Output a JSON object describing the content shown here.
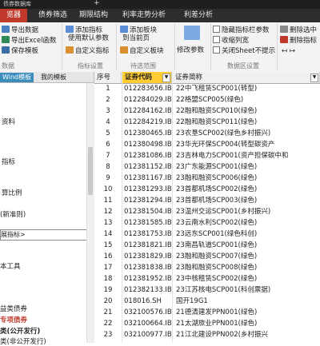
{
  "window": {
    "title": "债券数据库"
  },
  "menu": {
    "items": [
      {
        "label": "览器",
        "active": true
      },
      {
        "label": "债券筛选"
      },
      {
        "label": "期限结构"
      },
      {
        "label": "利率走势分析"
      },
      {
        "label": "利差分析"
      }
    ]
  },
  "ribbon": {
    "data_group": {
      "export_data": "导出数据",
      "export_excel": "导出Excel函数",
      "save_template": "保存模板",
      "label": "数据"
    },
    "indicator_group": {
      "add_indicator": "添加指标",
      "use_default": "使用默认参数",
      "custom_indicator": "自定义指标",
      "label": "指标设置"
    },
    "filter_group": {
      "add_board": "添加板块",
      "to_current_page": "到当前页",
      "custom_board": "自定义板块",
      "label": "待选范围"
    },
    "params": {
      "modify_params": "修改参数"
    },
    "view_group": {
      "hide_bar": "隐藏指标栏参数",
      "collapse_cols": "收缩列宽",
      "close_sheet": "关闭Sheet不提示",
      "label": "数据区设置"
    },
    "right": {
      "delete_selected": "删除选中",
      "delete_indicator": "删除指标",
      "arrows": "↤ ↦"
    }
  },
  "left_panel": {
    "tabs": [
      "Wind模板",
      "我的模板"
    ],
    "items": [
      "资料",
      "指标",
      "算比例",
      "(新准则)",
      "本工具",
      "益类债券",
      "专项债券",
      "类(公开发行)",
      "类(非公开发行)"
    ],
    "indicator_box": "展指标>"
  },
  "table": {
    "headers": {
      "seq": "序号",
      "code": "证券代码",
      "name": "证券简称"
    },
    "rows": [
      {
        "seq": "1",
        "code": "012283656.IB",
        "name": "22中飞租赁SCP001(转型)"
      },
      {
        "seq": "2",
        "code": "012284029.IB",
        "name": "22格盟SCP005(绿色)"
      },
      {
        "seq": "3",
        "code": "012284162.IB",
        "name": "22融和融资SCP010(绿色)"
      },
      {
        "seq": "4",
        "code": "012284219.IB",
        "name": "22融和融资SCP011(绿色)"
      },
      {
        "seq": "5",
        "code": "012380465.IB",
        "name": "23农垦SCP002(绿色乡村振兴)"
      },
      {
        "seq": "6",
        "code": "012380498.IB",
        "name": "23华光环保SCP004(转型碳资产"
      },
      {
        "seq": "7",
        "code": "012381086.IB",
        "name": "23吉林电力SCP001(资产担保碳中和"
      },
      {
        "seq": "8",
        "code": "012381152.IB",
        "name": "23广东能源SCP001(绿色)"
      },
      {
        "seq": "9",
        "code": "012381167.IB",
        "name": "23融和融资SCP006(绿色)"
      },
      {
        "seq": "10",
        "code": "012381293.IB",
        "name": "23首都机场SCP002(绿色)"
      },
      {
        "seq": "11",
        "code": "012381294.IB",
        "name": "23首都机场SCP003(绿色)"
      },
      {
        "seq": "12",
        "code": "012381504.IB",
        "name": "23温州交运SCP001(乡村振兴)"
      },
      {
        "seq": "13",
        "code": "012381585.IB",
        "name": "23云南水利SCP002(绿色)"
      },
      {
        "seq": "14",
        "code": "012381753.IB",
        "name": "23远东SCP001(绿色科创)"
      },
      {
        "seq": "15",
        "code": "012381821.IB",
        "name": "23南昌轨道SCP001(绿色)"
      },
      {
        "seq": "16",
        "code": "012381829.IB",
        "name": "23融和融资SCP007(绿色)"
      },
      {
        "seq": "17",
        "code": "012381838.IB",
        "name": "23融和融资SCP008(绿色)"
      },
      {
        "seq": "18",
        "code": "012381952.IB",
        "name": "23中核租赁SCP002(绿色)"
      },
      {
        "seq": "19",
        "code": "012382133.IB",
        "name": "23江苏核电SCP001(科创票据)"
      },
      {
        "seq": "20",
        "code": "018016.SH",
        "name": "国开19G1"
      },
      {
        "seq": "21",
        "code": "032100576.IB",
        "name": "21德清建发PPN001(绿色)"
      },
      {
        "seq": "22",
        "code": "032100664.IB",
        "name": "21太湖旅业PPN001(绿色)"
      },
      {
        "seq": "23",
        "code": "032100977.IB",
        "name": "21江北建设PPN002(乡村振兴"
      }
    ]
  },
  "colors": {
    "menu_active": "#c0392b",
    "header_selected": "#ffcc33",
    "tab_active": "#3c8dbc"
  }
}
